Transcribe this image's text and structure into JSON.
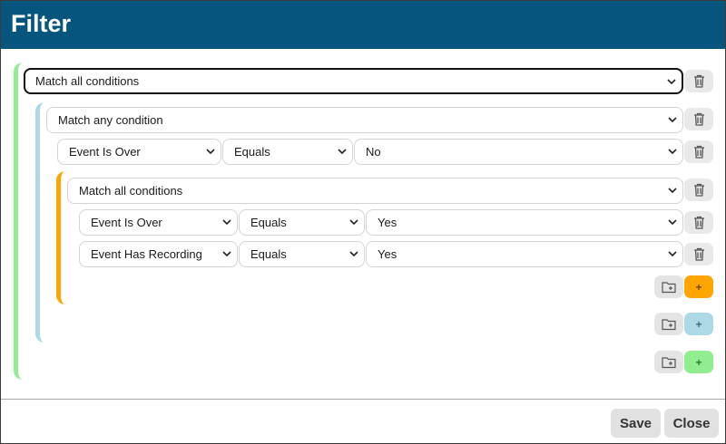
{
  "dialog": {
    "title": "Filter",
    "footer": {
      "save_label": "Save",
      "close_label": "Close"
    }
  },
  "colors": {
    "header": "#06557f",
    "level0_accent": "#90ee90",
    "level1_accent": "#add8e6",
    "level2_accent": "#ffa500"
  },
  "filter": {
    "root_match": "Match all conditions",
    "group1": {
      "match": "Match any condition",
      "condition": {
        "field": "Event Is Over",
        "operator": "Equals",
        "value": "No"
      },
      "group2": {
        "match": "Match all conditions",
        "conditions": [
          {
            "field": "Event Is Over",
            "operator": "Equals",
            "value": "Yes"
          },
          {
            "field": "Event Has Recording",
            "operator": "Equals",
            "value": "Yes"
          }
        ],
        "add_label": "+"
      },
      "add_label": "+"
    },
    "add_label": "+"
  }
}
